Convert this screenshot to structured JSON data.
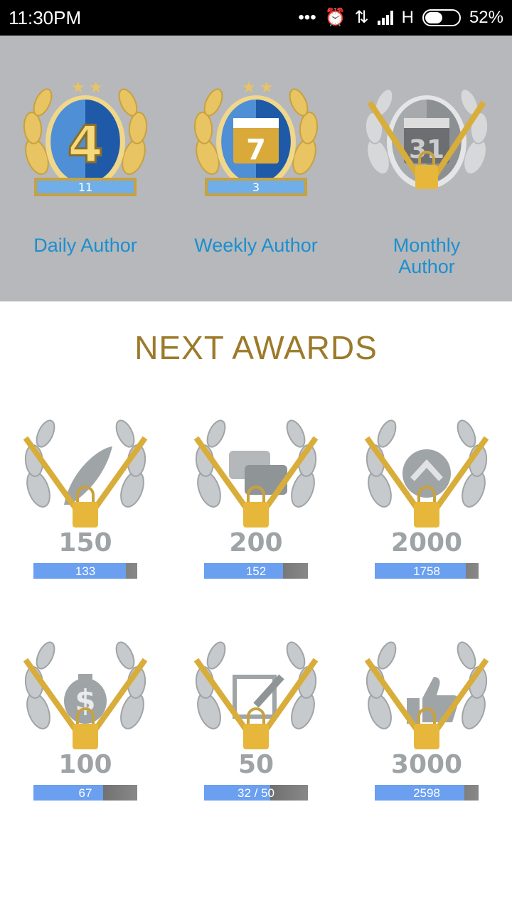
{
  "status_bar": {
    "time": "11:30PM",
    "icons": [
      "more-dots-icon",
      "alarm-icon",
      "data-transfer-icon",
      "signal-icon",
      "network-type-icon",
      "battery-icon"
    ],
    "network_type": "H",
    "battery": "52%"
  },
  "earned_awards": [
    {
      "label": "Daily Author",
      "count": "11",
      "number": "4",
      "locked": false
    },
    {
      "label": "Weekly Author",
      "count": "3",
      "number": "7",
      "locked": false
    },
    {
      "label": "Monthly Author",
      "count": "",
      "number": "31",
      "locked": true
    }
  ],
  "next_awards_title": "NEXT AWARDS",
  "next_awards": [
    {
      "icon": "feather-icon",
      "target": "150",
      "progress_text": "133",
      "progress": 0.887
    },
    {
      "icon": "chat-bubbles-icon",
      "target": "200",
      "progress_text": "152",
      "progress": 0.76
    },
    {
      "icon": "upvote-icon",
      "target": "2000",
      "progress_text": "1758",
      "progress": 0.879
    },
    {
      "icon": "money-bag-icon",
      "target": "100",
      "progress_text": "67",
      "progress": 0.67
    },
    {
      "icon": "edit-icon",
      "target": "50",
      "progress_text": "32 / 50",
      "progress": 0.64
    },
    {
      "icon": "thumbs-up-icon",
      "target": "3000",
      "progress_text": "2598",
      "progress": 0.866
    }
  ],
  "colors": {
    "panel_bg": "#b6b8bb",
    "label_blue": "#1b8fd0",
    "title_gold": "#9c7a2a",
    "progress_blue": "#6b9ff0"
  }
}
